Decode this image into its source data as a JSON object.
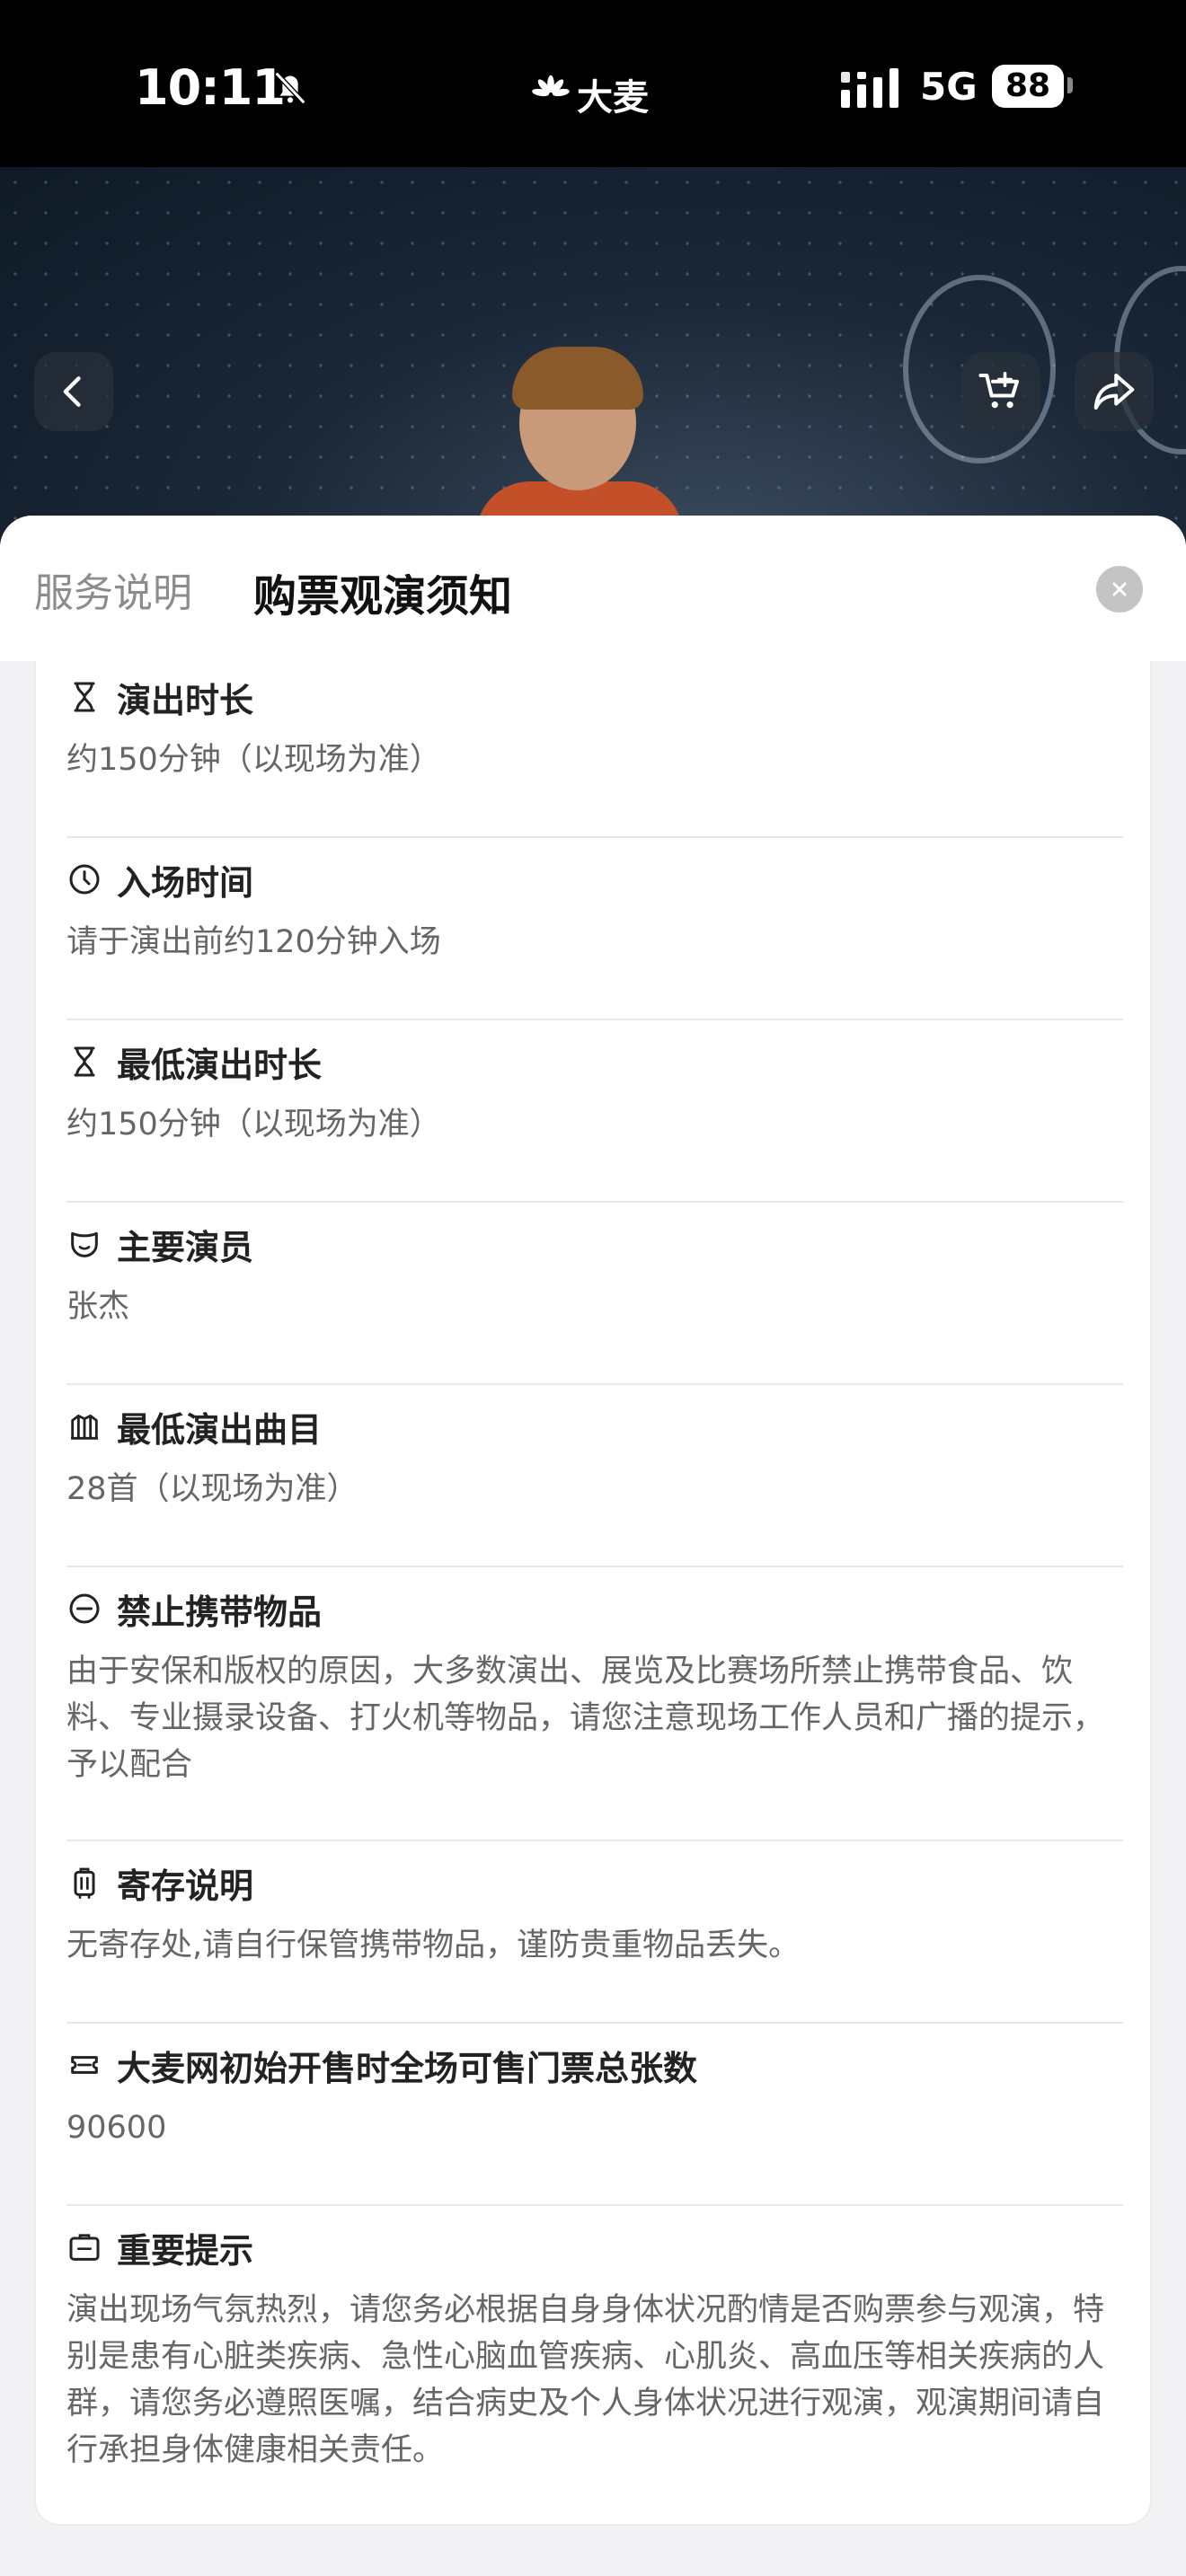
{
  "status_bar": {
    "time": "10:11",
    "brand": "大麦",
    "network": "5G",
    "battery": "88"
  },
  "header": {
    "tabs": [
      {
        "label": "服务说明",
        "active": false
      },
      {
        "label": "购票观演须知",
        "active": true
      }
    ]
  },
  "items": [
    {
      "icon": "hourglass-icon",
      "title": "演出时长",
      "body": "约150分钟（以现场为准）"
    },
    {
      "icon": "clock-icon",
      "title": "入场时间",
      "body": "请于演出前约120分钟入场"
    },
    {
      "icon": "hourglass-icon",
      "title": "最低演出时长",
      "body": "约150分钟（以现场为准）"
    },
    {
      "icon": "mask-icon",
      "title": "主要演员",
      "body": "张杰"
    },
    {
      "icon": "music-sheet-icon",
      "title": "最低演出曲目",
      "body": "28首（以现场为准）"
    },
    {
      "icon": "prohibited-icon",
      "title": "禁止携带物品",
      "body": "由于安保和版权的原因，大多数演出、展览及比赛场所禁止携带食品、饮料、专业摄录设备、打火机等物品，请您注意现场工作人员和广播的提示，予以配合"
    },
    {
      "icon": "luggage-icon",
      "title": "寄存说明",
      "body": "无寄存处,请自行保管携带物品，谨防贵重物品丢失。"
    },
    {
      "icon": "ticket-icon",
      "title": "大麦网初始开售时全场可售门票总张数",
      "body": "90600"
    },
    {
      "icon": "notice-icon",
      "title": "重要提示",
      "body": "演出现场气氛热烈，请您务必根据自身身体状况酌情是否购票参与观演，特别是患有心脏类疾病、急性心脑血管疾病、心肌炎、高血压等相关疾病的人群，请您务必遵照医嘱，结合病史及个人身体状况进行观演，观演期间请自行承担身体健康相关责任。"
    }
  ]
}
